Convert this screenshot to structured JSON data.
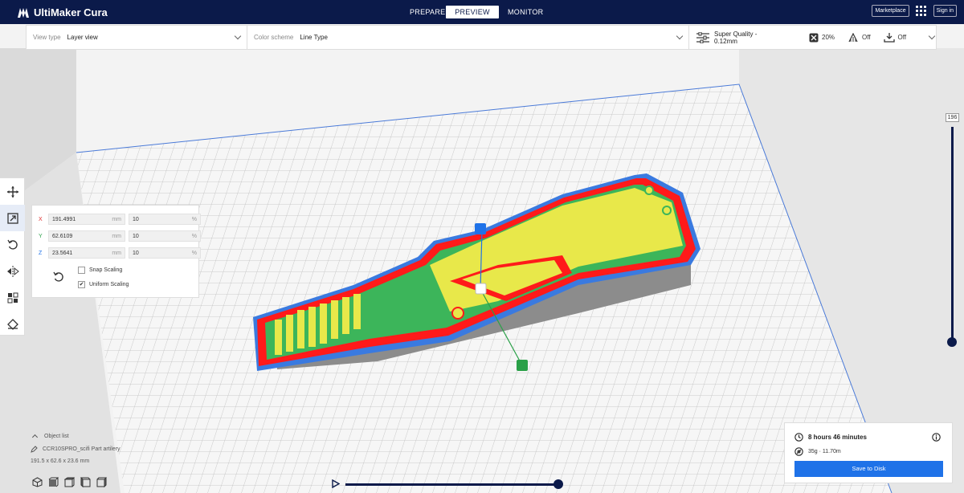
{
  "app": {
    "name": "UltiMaker Cura"
  },
  "stages": [
    {
      "label": "PREPARE"
    },
    {
      "label": "PREVIEW",
      "active": true
    },
    {
      "label": "MONITOR"
    }
  ],
  "header_right": {
    "marketplace": "Marketplace",
    "signin": "Sign in"
  },
  "settings_bar": {
    "view_type_label": "View type",
    "view_type_value": "Layer view",
    "color_scheme_label": "Color scheme",
    "color_scheme_value": "Line Type",
    "profile": "Super Quality - 0.12mm",
    "infill": "20%",
    "support": "Off",
    "adhesion": "Off"
  },
  "scale_panel": {
    "x_label": "X",
    "x_mm": "191.4991",
    "x_pct": "10",
    "y_label": "Y",
    "y_mm": "62.6109",
    "y_pct": "10",
    "z_label": "Z",
    "z_mm": "23.5641",
    "z_pct": "10",
    "unit_mm": "mm",
    "unit_pct": "%",
    "snap_scaling": "Snap Scaling",
    "snap_checked": false,
    "uniform_scaling": "Uniform Scaling",
    "uniform_checked": true
  },
  "layer_slider": {
    "max_layer": "196",
    "level": 1.0
  },
  "object_list": {
    "title": "Object list",
    "object_name": "CCR10SPRO_scifi Part artilery",
    "dimensions": "191.5 x 62.6 x 23.6 mm"
  },
  "timeline": {
    "level": 1.0
  },
  "print_info": {
    "time": "8 hours 46 minutes",
    "material": "35g · 11.70m",
    "save_button": "Save to Disk"
  },
  "colors": {
    "header": "#0b1a4a",
    "accent": "#1f72e8",
    "wall_outer": "#ff1a1a",
    "infill": "#e8e84a",
    "skin": "#3cb55a",
    "support_shell": "#3a7ae0"
  }
}
